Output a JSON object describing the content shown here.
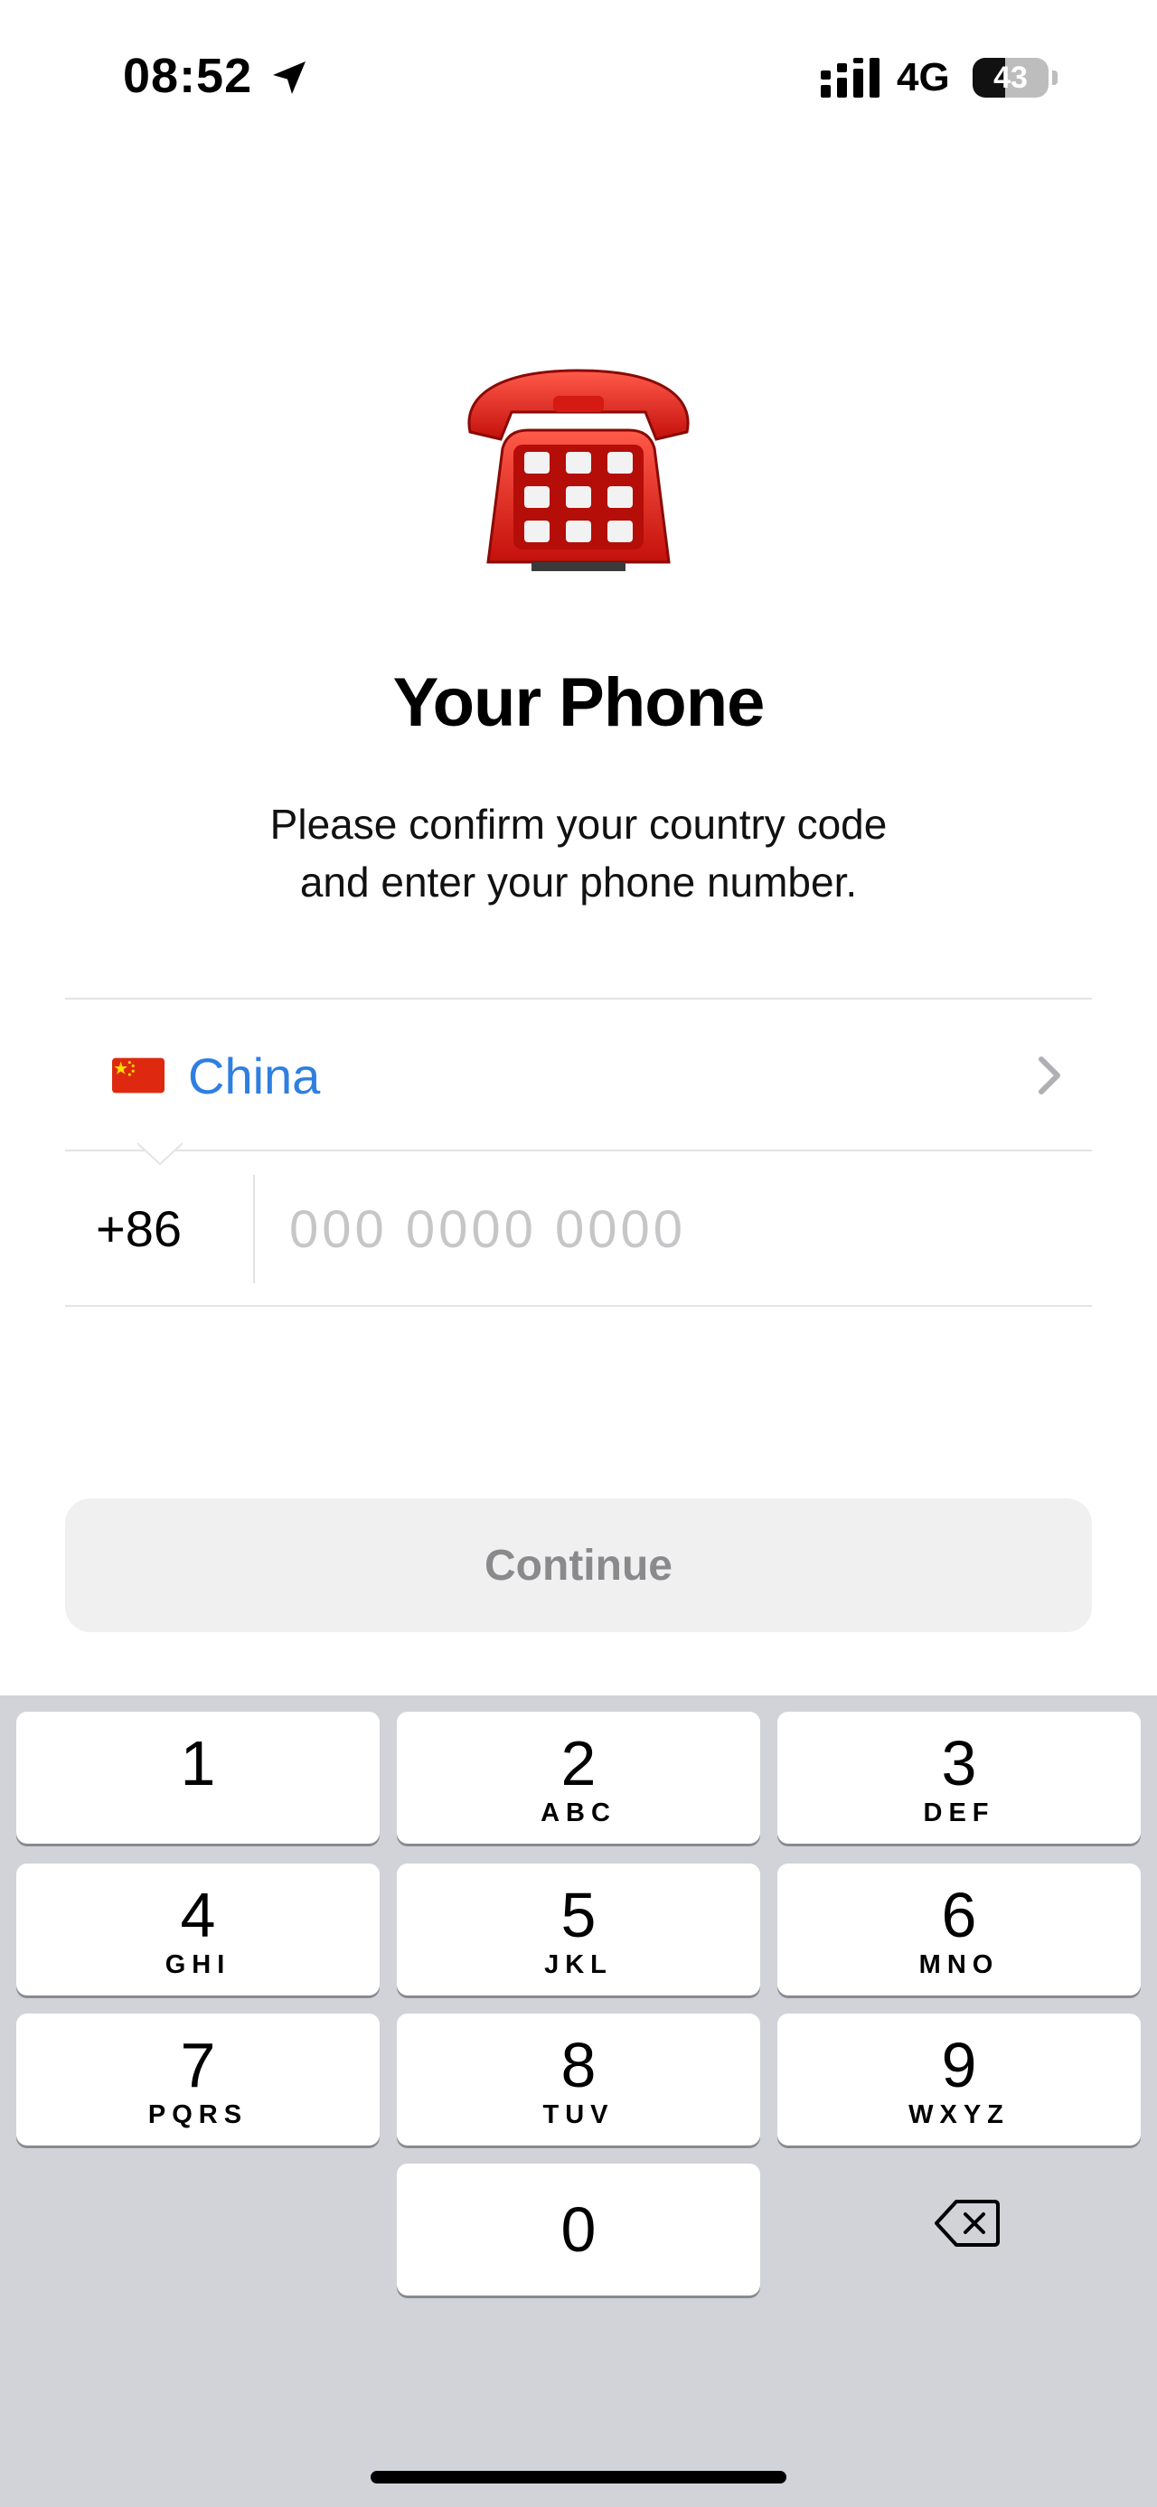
{
  "status_bar": {
    "time": "08:52",
    "network": "4G",
    "battery_level": "43",
    "battery_fraction": 0.43
  },
  "header": {
    "title": "Your Phone",
    "subtitle_line1": "Please confirm your country code",
    "subtitle_line2": "and enter your phone number."
  },
  "country": {
    "name": "China",
    "flag": "china-flag-icon",
    "code": "+86"
  },
  "phone_input": {
    "value": "",
    "placeholder": "000 0000 0000"
  },
  "continue_label": "Continue",
  "colors": {
    "accent": "#2f7fe0",
    "button_bg": "#f0f0f1",
    "button_text": "#8a8a8d",
    "keyboard_bg": "#d1d3d9"
  },
  "keypad": {
    "keys": [
      {
        "digit": "1",
        "letters": ""
      },
      {
        "digit": "2",
        "letters": "ABC"
      },
      {
        "digit": "3",
        "letters": "DEF"
      },
      {
        "digit": "4",
        "letters": "GHI"
      },
      {
        "digit": "5",
        "letters": "JKL"
      },
      {
        "digit": "6",
        "letters": "MNO"
      },
      {
        "digit": "7",
        "letters": "PQRS"
      },
      {
        "digit": "8",
        "letters": "TUV"
      },
      {
        "digit": "9",
        "letters": "WXYZ"
      },
      {
        "digit": "0",
        "letters": ""
      }
    ],
    "delete_icon": "backspace-icon"
  }
}
